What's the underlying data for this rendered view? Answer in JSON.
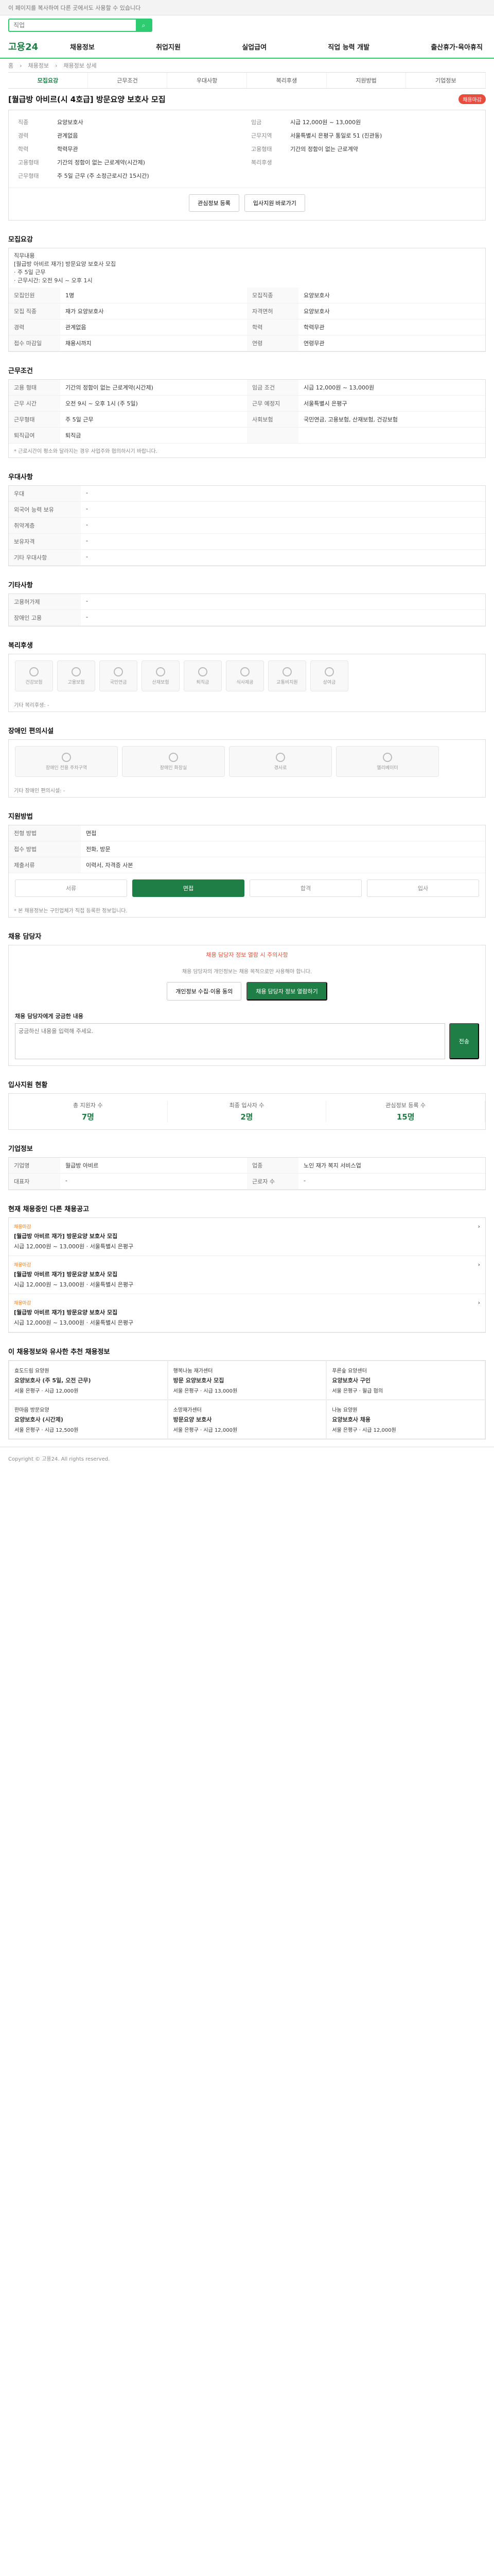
{
  "topbar": {
    "text": "이 페이지를 복사하여 다른 곳에서도 사용할 수 있습니다"
  },
  "search": {
    "placeholder": "직업"
  },
  "nav": {
    "logo": "고용24",
    "items": [
      "채용정보",
      "취업지원",
      "실업급여",
      "직업 능력 개발",
      "출산휴가·육아휴직"
    ]
  },
  "breadcrumb": [
    "홈",
    "채용정보",
    "채용정보 상세"
  ],
  "tabs": [
    "모집요강",
    "근무조건",
    "우대사항",
    "복리후생",
    "지원방법",
    "기업정보"
  ],
  "title": "[월급방 아비르(시 4호급] 방문요양 보호사 모집",
  "badge": "채용마감",
  "summary": {
    "left": [
      {
        "k": "직종",
        "v": "요양보호사"
      },
      {
        "k": "경력",
        "v": "관계없음"
      },
      {
        "k": "학력",
        "v": "학력무관"
      }
    ],
    "right": [
      {
        "k": "임금",
        "v": "시급 12,000원 ~ 13,000원"
      },
      {
        "k": "근무지역",
        "v": "서울특별시 은평구 통일로 51 (진관동)"
      },
      {
        "k": "고용형태",
        "v": "기간의 정함이 없는 근로계약"
      }
    ],
    "bottom_left": [
      {
        "k": "고용형태",
        "v": "기간의 정함이 없는 근로계약(시간제)"
      },
      {
        "k": "근무형태",
        "v": "주 5일 근무 (주 소정근로시간 15시간)"
      }
    ],
    "bottom_right": [
      {
        "k": "복리후생",
        "v": ""
      }
    ]
  },
  "actions": {
    "a": "관심정보 등록",
    "b": "입사지원 바로가기"
  },
  "sec1": {
    "title": "모집요강",
    "body": "직무내용\n[월급방 아비르 재가] 방문요양 보호사 모집\n· 주 5일 근무\n· 근무시간: 오전 9시 ~ 오후 1시"
  },
  "recruit": [
    {
      "k": "모집인원",
      "v": "1명"
    },
    {
      "k": "모집직종",
      "v": "요양보호사"
    },
    {
      "k": "모집 직종",
      "v": "재가 요양보호사"
    },
    {
      "k": "자격면허",
      "v": "요양보호사"
    },
    {
      "k": "경력",
      "v": "관계없음"
    },
    {
      "k": "학력",
      "v": "학력무관"
    },
    {
      "k": "접수 마감일",
      "v": "채용시까지"
    },
    {
      "k": "연령",
      "v": "연령무관"
    }
  ],
  "workcond": {
    "title": "근무조건",
    "rows": [
      {
        "k": "고용 형태",
        "v": "기간의 정함이 없는 근로계약(시간제)"
      },
      {
        "k": "임금 조건",
        "v": "시급 12,000원 ~ 13,000원"
      },
      {
        "k": "근무 시간",
        "v": "오전 9시 ~ 오후 1시 (주 5일)"
      },
      {
        "k": "근무 예정지",
        "v": "서울특별시 은평구"
      },
      {
        "k": "근무형태",
        "v": "주 5일 근무"
      },
      {
        "k": "사회보험",
        "v": "국민연금, 고용보험, 산재보험, 건강보험"
      },
      {
        "k": "퇴직급여",
        "v": "퇴직금"
      }
    ],
    "note": "* 근로시간이 평소와 달라지는 경우 사업주와 협의하시기 바랍니다."
  },
  "prefs": {
    "title": "우대사항",
    "rows": [
      {
        "k": "우대",
        "v": "-"
      },
      {
        "k": "외국어 능력 보유",
        "v": "-"
      },
      {
        "k": "취약계층",
        "v": "-"
      },
      {
        "k": "보유자격",
        "v": "-"
      },
      {
        "k": "기타 우대사항",
        "v": "-"
      }
    ]
  },
  "etc": {
    "title": "기타사항",
    "rows": [
      {
        "k": "고용허가제",
        "v": "-"
      },
      {
        "k": "장애인 고용",
        "v": "-"
      }
    ]
  },
  "benefit": {
    "title": "복리후생",
    "icons": [
      "건강보험",
      "고용보험",
      "국민연금",
      "산재보험",
      "퇴직금",
      "식사제공",
      "교통비지원",
      "상여금"
    ],
    "note": "기타 복리후생: -"
  },
  "disability": {
    "title": "장애인 편의시설",
    "icons": [
      "장애인 전용 주차구역",
      "장애인 화장실",
      "경사로",
      "엘리베이터"
    ],
    "note": "기타 장애인 편의시설: -"
  },
  "apply": {
    "title": "지원방법",
    "rows": [
      {
        "k": "전형 방법",
        "v": "면접"
      },
      {
        "k": "접수 방법",
        "v": "전화, 방문"
      },
      {
        "k": "제출서류",
        "v": "이력서, 자격증 사본"
      }
    ],
    "steps": [
      "서류",
      "면접",
      "합격",
      "입사"
    ],
    "note": "* 본 채용정보는 구인업체가 직접 등록한 정보입니다."
  },
  "contact": {
    "title": "채용 담당자",
    "alert": "채용 담당자 정보 열람 시 주의사항",
    "desc": "채용 담당자의 개인정보는 채용 목적으로만 사용해야 합니다.",
    "btn_a": "개인정보 수집·이용 동의",
    "btn_b": "채용 담당자 정보 열람하기",
    "question_label": "채용 담당자에게 궁금한 내용",
    "placeholder": "궁금하신 내용을 입력해 주세요.",
    "submit": "전송"
  },
  "stats": {
    "title": "입사지원 현황",
    "items": [
      {
        "label": "총 지원자 수",
        "value": "7명"
      },
      {
        "label": "최종 입사자 수",
        "value": "2명"
      },
      {
        "label": "관심정보 등록 수",
        "value": "15명"
      }
    ]
  },
  "company": {
    "title": "기업정보",
    "rows": [
      {
        "k": "기업명",
        "v": "월급방 아비르"
      },
      {
        "k": "업종",
        "v": "노인 재가 복지 서비스업"
      },
      {
        "k": "대표자",
        "v": "-"
      },
      {
        "k": "근로자 수",
        "v": "-"
      }
    ]
  },
  "jobs": {
    "title": "현재 채용중인 다른 채용공고",
    "items": [
      {
        "tag": "채용마감",
        "title": "[월급방 아비르 재가] 방문요양 보호사 모집",
        "sub": "시급 12,000원 ~ 13,000원 · 서울특별시 은평구"
      },
      {
        "tag": "채용마감",
        "title": "[월급방 아비르 재가] 방문요양 보호사 모집",
        "sub": "시급 12,000원 ~ 13,000원 · 서울특별시 은평구"
      },
      {
        "tag": "채용마감",
        "title": "[월급방 아비르 재가] 방문요양 보호사 모집",
        "sub": "시급 12,000원 ~ 13,000원 · 서울특별시 은평구"
      }
    ]
  },
  "recs": {
    "title": "이 채용정보와 유사한 추천 채용정보",
    "items": [
      {
        "co": "효도드림 요양원",
        "title": "요양보호사 (주 5일, 오전 근무)",
        "sub": "서울 은평구 · 시급 12,000원"
      },
      {
        "co": "행복나눔 재가센터",
        "title": "방문 요양보호사 모집",
        "sub": "서울 은평구 · 시급 13,000원"
      },
      {
        "co": "푸른숲 요양센터",
        "title": "요양보호사 구인",
        "sub": "서울 은평구 · 월급 협의"
      },
      {
        "co": "한마음 방문요양",
        "title": "요양보호사 (시간제)",
        "sub": "서울 은평구 · 시급 12,500원"
      },
      {
        "co": "소망재가센터",
        "title": "방문요양 보호사",
        "sub": "서울 은평구 · 시급 12,000원"
      },
      {
        "co": "나눔 요양원",
        "title": "요양보호사 채용",
        "sub": "서울 은평구 · 시급 12,000원"
      }
    ]
  },
  "footer": "Copyright © 고용24. All rights reserved."
}
